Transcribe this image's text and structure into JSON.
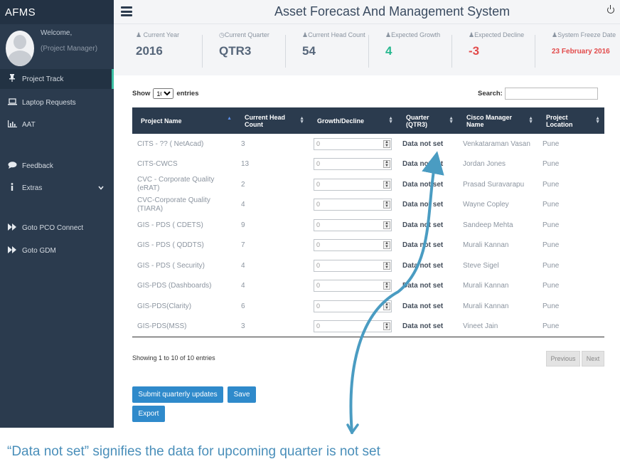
{
  "sidebar": {
    "brand": "AFMS",
    "welcome": "Welcome,",
    "role": "(Project Manager)",
    "items": [
      {
        "label": "Project Track",
        "icon": "pin-icon"
      },
      {
        "label": "Laptop Requests",
        "icon": "laptop-icon"
      },
      {
        "label": "AAT",
        "icon": "bar-chart-icon"
      },
      {
        "label": "Feedback",
        "icon": "chat-icon"
      },
      {
        "label": "Extras",
        "icon": "info-icon"
      },
      {
        "label": "Goto PCO Connect",
        "icon": "fast-forward-icon"
      },
      {
        "label": "Goto GDM",
        "icon": "fast-forward-icon"
      }
    ]
  },
  "header": {
    "title": "Asset Forecast And Management System"
  },
  "stats": [
    {
      "label": "Current Year",
      "value": "2016"
    },
    {
      "label": "Current Quarter",
      "value": "QTR3"
    },
    {
      "label": "Current Head Count",
      "value": "54"
    },
    {
      "label": "Expected Growth",
      "value": "4"
    },
    {
      "label": "Expected Decline",
      "value": "-3"
    },
    {
      "label": "System Freeze Date",
      "value": "23 February 2016"
    }
  ],
  "table_controls": {
    "show": "Show",
    "entries_value": "10",
    "entries": "entries",
    "search": "Search:"
  },
  "table": {
    "columns": [
      "Project Name",
      "Current Head Count",
      "Growth/Decline",
      "Quarter (QTR3)",
      "Cisco Manager Name",
      "Project Location"
    ],
    "rows": [
      {
        "name": "CITS - ?? ( NetAcad)",
        "count": "3",
        "growth": "0",
        "quarter": "Data not set",
        "manager": "Venkataraman Vasan",
        "location": "Pune"
      },
      {
        "name": "CITS-CWCS",
        "count": "13",
        "growth": "0",
        "quarter": "Data not set",
        "manager": "Jordan Jones",
        "location": "Pune"
      },
      {
        "name": "CVC - Corporate Quality (eRAT)",
        "count": "2",
        "growth": "0",
        "quarter": "Data not set",
        "manager": "Prasad Suravarapu",
        "location": "Pune"
      },
      {
        "name": "CVC-Corporate Quality (TIARA)",
        "count": "4",
        "growth": "0",
        "quarter": "Data not set",
        "manager": "Wayne Copley",
        "location": "Pune"
      },
      {
        "name": "GIS - PDS ( CDETS)",
        "count": "9",
        "growth": "0",
        "quarter": "Data not set",
        "manager": "Sandeep Mehta",
        "location": "Pune"
      },
      {
        "name": "GIS - PDS ( QDDTS)",
        "count": "7",
        "growth": "0",
        "quarter": "Data not set",
        "manager": "Murali Kannan",
        "location": "Pune"
      },
      {
        "name": "GIS - PDS ( Security)",
        "count": "4",
        "growth": "0",
        "quarter": "Data not set",
        "manager": "Steve Sigel",
        "location": "Pune"
      },
      {
        "name": "GIS-PDS (Dashboards)",
        "count": "4",
        "growth": "0",
        "quarter": "Data not set",
        "manager": "Murali Kannan",
        "location": "Pune"
      },
      {
        "name": "GIS-PDS(Clarity)",
        "count": "6",
        "growth": "0",
        "quarter": "Data not set",
        "manager": "Murali Kannan",
        "location": "Pune"
      },
      {
        "name": "GIS-PDS(MSS)",
        "count": "3",
        "growth": "0",
        "quarter": "Data not set",
        "manager": "Vineet Jain",
        "location": "Pune"
      }
    ]
  },
  "footer": {
    "info": "Showing 1 to 10 of 10 entries",
    "previous": "Previous",
    "next": "Next",
    "submit": "Submit quarterly updates",
    "save": "Save",
    "export": "Export"
  },
  "caption": "“Data not set” signifies the data for upcoming quarter is not set",
  "colors": {
    "sidebar": "#2b3b4e",
    "accent_green": "#27b88f",
    "accent_red": "#e24b4b",
    "button": "#2f8acb",
    "annotation": "#4a9cc2"
  }
}
